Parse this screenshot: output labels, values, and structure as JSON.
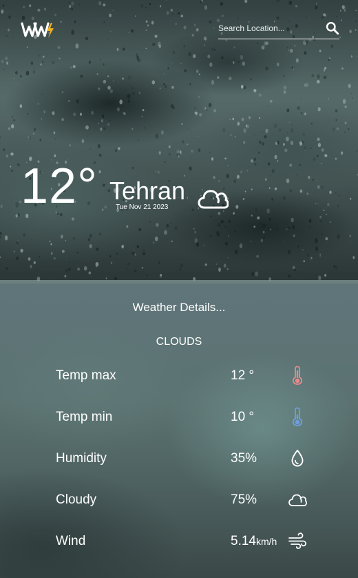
{
  "header": {
    "logo_text": "WW",
    "search_placeholder": "Search Location...",
    "search_icon": "search-icon"
  },
  "current": {
    "temperature": "12°",
    "city": "Tehran",
    "date": "Tue Nov 21 2023",
    "condition_icon": "cloud-icon"
  },
  "details": {
    "title": "Weather Details...",
    "condition": "CLOUDS",
    "rows": [
      {
        "label": "Temp max",
        "value": "12 °",
        "unit": "",
        "icon": "thermometer-hot-icon",
        "icon_color": "#e88a8a"
      },
      {
        "label": "Temp min",
        "value": "10 °",
        "unit": "",
        "icon": "thermometer-cold-icon",
        "icon_color": "#6f9ee0"
      },
      {
        "label": "Humidity",
        "value": "35%",
        "unit": "",
        "icon": "droplet-icon",
        "icon_color": "#ffffff"
      },
      {
        "label": "Cloudy",
        "value": "75%",
        "unit": "",
        "icon": "cloud-icon",
        "icon_color": "#ffffff"
      },
      {
        "label": "Wind",
        "value": "5.14",
        "unit": "km/h",
        "icon": "wind-icon",
        "icon_color": "#ffffff"
      }
    ]
  },
  "colors": {
    "logo_accent": "#f2b01e",
    "text": "#ffffff"
  }
}
